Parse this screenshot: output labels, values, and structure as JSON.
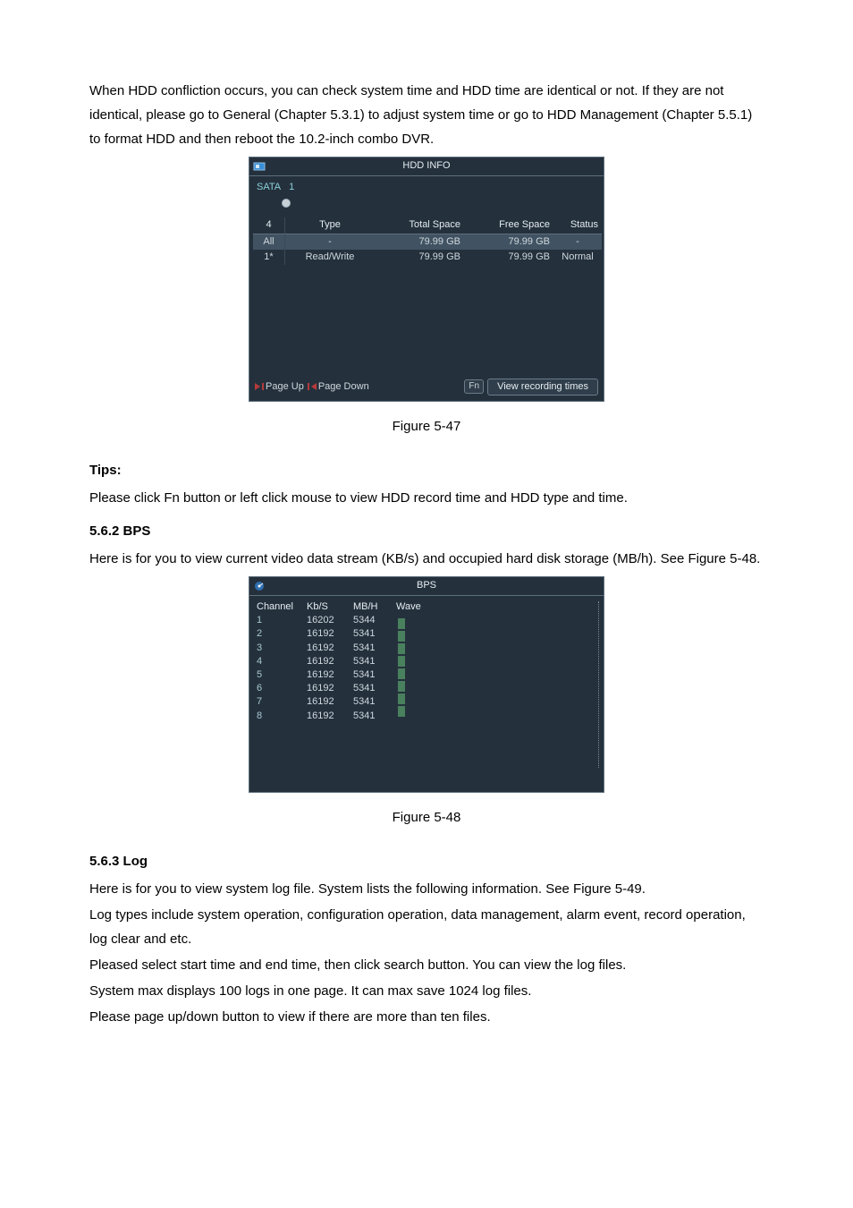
{
  "doc": {
    "p1": "When HDD confliction occurs, you can check system time and HDD time are identical or not. If they are not identical, please go to General (Chapter 5.3.1) to adjust system time or go to HDD Management (Chapter 5.5.1) to format HDD and then reboot the 10.2-inch combo DVR.",
    "fig1_caption": "Figure 5-47",
    "tips_label": "Tips:",
    "tips_text": "Please click Fn button or left click mouse to view HDD record time and HDD type and time.",
    "h562": "5.6.2  BPS",
    "p562": "Here is for you to view current video data stream (KB/s) and occupied hard disk storage (MB/h). See Figure 5-48.",
    "fig2_caption": "Figure 5-48",
    "h563": "5.6.3  Log",
    "p563a": "Here is for you to view system log file. System lists the following information. See Figure 5-49.",
    "p563b": "Log types include system operation, configuration operation, data management, alarm event, record operation, log clear and etc.",
    "p563c": "Pleased select start time and end time, then click search button. You can view the log files.",
    "p563d": "System max displays 100 logs in one page. It can max save 1024 log files.",
    "p563e": "Please page up/down button to view if there are more than ten files."
  },
  "hdd": {
    "title": "HDD INFO",
    "sata_label": "SATA",
    "sata_num": "1",
    "cols": {
      "c1": "4",
      "c2": "Type",
      "c3": "Total Space",
      "c4": "Free Space",
      "c5": "Status"
    },
    "row_all": {
      "c1": "All",
      "c2": "-",
      "c3": "79.99 GB",
      "c4": "79.99 GB",
      "c5": "-"
    },
    "row1": {
      "c1": "1*",
      "c2": "Read/Write",
      "c3": "79.99 GB",
      "c4": "79.99 GB",
      "c5": "Normal"
    },
    "pageup": "Page Up",
    "pagedown": "Page Down",
    "fn": "Fn",
    "view_btn": "View recording times"
  },
  "bps": {
    "title": "BPS",
    "headers": {
      "ch": "Channel",
      "kbs": "Kb/S",
      "mbh": "MB/H",
      "wave": "Wave"
    },
    "rows": [
      {
        "ch": "1",
        "kbs": "16202",
        "mbh": "5344"
      },
      {
        "ch": "2",
        "kbs": "16192",
        "mbh": "5341"
      },
      {
        "ch": "3",
        "kbs": "16192",
        "mbh": "5341"
      },
      {
        "ch": "4",
        "kbs": "16192",
        "mbh": "5341"
      },
      {
        "ch": "5",
        "kbs": "16192",
        "mbh": "5341"
      },
      {
        "ch": "6",
        "kbs": "16192",
        "mbh": "5341"
      },
      {
        "ch": "7",
        "kbs": "16192",
        "mbh": "5341"
      },
      {
        "ch": "8",
        "kbs": "16192",
        "mbh": "5341"
      }
    ]
  }
}
